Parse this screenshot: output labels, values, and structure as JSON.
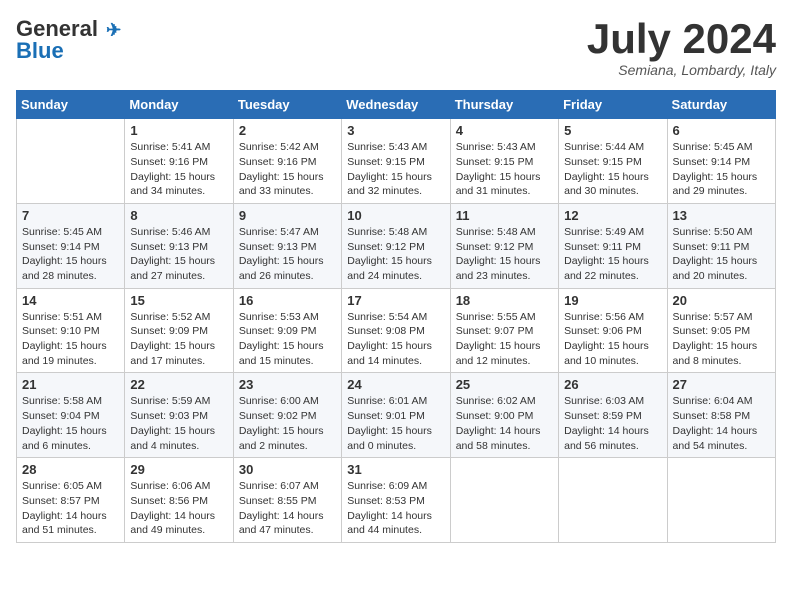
{
  "header": {
    "logo_line1": "General",
    "logo_line2": "Blue",
    "month_year": "July 2024",
    "location": "Semiana, Lombardy, Italy"
  },
  "weekdays": [
    "Sunday",
    "Monday",
    "Tuesday",
    "Wednesday",
    "Thursday",
    "Friday",
    "Saturday"
  ],
  "weeks": [
    [
      {
        "day": "",
        "info": ""
      },
      {
        "day": "1",
        "info": "Sunrise: 5:41 AM\nSunset: 9:16 PM\nDaylight: 15 hours\nand 34 minutes."
      },
      {
        "day": "2",
        "info": "Sunrise: 5:42 AM\nSunset: 9:16 PM\nDaylight: 15 hours\nand 33 minutes."
      },
      {
        "day": "3",
        "info": "Sunrise: 5:43 AM\nSunset: 9:15 PM\nDaylight: 15 hours\nand 32 minutes."
      },
      {
        "day": "4",
        "info": "Sunrise: 5:43 AM\nSunset: 9:15 PM\nDaylight: 15 hours\nand 31 minutes."
      },
      {
        "day": "5",
        "info": "Sunrise: 5:44 AM\nSunset: 9:15 PM\nDaylight: 15 hours\nand 30 minutes."
      },
      {
        "day": "6",
        "info": "Sunrise: 5:45 AM\nSunset: 9:14 PM\nDaylight: 15 hours\nand 29 minutes."
      }
    ],
    [
      {
        "day": "7",
        "info": "Sunrise: 5:45 AM\nSunset: 9:14 PM\nDaylight: 15 hours\nand 28 minutes."
      },
      {
        "day": "8",
        "info": "Sunrise: 5:46 AM\nSunset: 9:13 PM\nDaylight: 15 hours\nand 27 minutes."
      },
      {
        "day": "9",
        "info": "Sunrise: 5:47 AM\nSunset: 9:13 PM\nDaylight: 15 hours\nand 26 minutes."
      },
      {
        "day": "10",
        "info": "Sunrise: 5:48 AM\nSunset: 9:12 PM\nDaylight: 15 hours\nand 24 minutes."
      },
      {
        "day": "11",
        "info": "Sunrise: 5:48 AM\nSunset: 9:12 PM\nDaylight: 15 hours\nand 23 minutes."
      },
      {
        "day": "12",
        "info": "Sunrise: 5:49 AM\nSunset: 9:11 PM\nDaylight: 15 hours\nand 22 minutes."
      },
      {
        "day": "13",
        "info": "Sunrise: 5:50 AM\nSunset: 9:11 PM\nDaylight: 15 hours\nand 20 minutes."
      }
    ],
    [
      {
        "day": "14",
        "info": "Sunrise: 5:51 AM\nSunset: 9:10 PM\nDaylight: 15 hours\nand 19 minutes."
      },
      {
        "day": "15",
        "info": "Sunrise: 5:52 AM\nSunset: 9:09 PM\nDaylight: 15 hours\nand 17 minutes."
      },
      {
        "day": "16",
        "info": "Sunrise: 5:53 AM\nSunset: 9:09 PM\nDaylight: 15 hours\nand 15 minutes."
      },
      {
        "day": "17",
        "info": "Sunrise: 5:54 AM\nSunset: 9:08 PM\nDaylight: 15 hours\nand 14 minutes."
      },
      {
        "day": "18",
        "info": "Sunrise: 5:55 AM\nSunset: 9:07 PM\nDaylight: 15 hours\nand 12 minutes."
      },
      {
        "day": "19",
        "info": "Sunrise: 5:56 AM\nSunset: 9:06 PM\nDaylight: 15 hours\nand 10 minutes."
      },
      {
        "day": "20",
        "info": "Sunrise: 5:57 AM\nSunset: 9:05 PM\nDaylight: 15 hours\nand 8 minutes."
      }
    ],
    [
      {
        "day": "21",
        "info": "Sunrise: 5:58 AM\nSunset: 9:04 PM\nDaylight: 15 hours\nand 6 minutes."
      },
      {
        "day": "22",
        "info": "Sunrise: 5:59 AM\nSunset: 9:03 PM\nDaylight: 15 hours\nand 4 minutes."
      },
      {
        "day": "23",
        "info": "Sunrise: 6:00 AM\nSunset: 9:02 PM\nDaylight: 15 hours\nand 2 minutes."
      },
      {
        "day": "24",
        "info": "Sunrise: 6:01 AM\nSunset: 9:01 PM\nDaylight: 15 hours\nand 0 minutes."
      },
      {
        "day": "25",
        "info": "Sunrise: 6:02 AM\nSunset: 9:00 PM\nDaylight: 14 hours\nand 58 minutes."
      },
      {
        "day": "26",
        "info": "Sunrise: 6:03 AM\nSunset: 8:59 PM\nDaylight: 14 hours\nand 56 minutes."
      },
      {
        "day": "27",
        "info": "Sunrise: 6:04 AM\nSunset: 8:58 PM\nDaylight: 14 hours\nand 54 minutes."
      }
    ],
    [
      {
        "day": "28",
        "info": "Sunrise: 6:05 AM\nSunset: 8:57 PM\nDaylight: 14 hours\nand 51 minutes."
      },
      {
        "day": "29",
        "info": "Sunrise: 6:06 AM\nSunset: 8:56 PM\nDaylight: 14 hours\nand 49 minutes."
      },
      {
        "day": "30",
        "info": "Sunrise: 6:07 AM\nSunset: 8:55 PM\nDaylight: 14 hours\nand 47 minutes."
      },
      {
        "day": "31",
        "info": "Sunrise: 6:09 AM\nSunset: 8:53 PM\nDaylight: 14 hours\nand 44 minutes."
      },
      {
        "day": "",
        "info": ""
      },
      {
        "day": "",
        "info": ""
      },
      {
        "day": "",
        "info": ""
      }
    ]
  ]
}
